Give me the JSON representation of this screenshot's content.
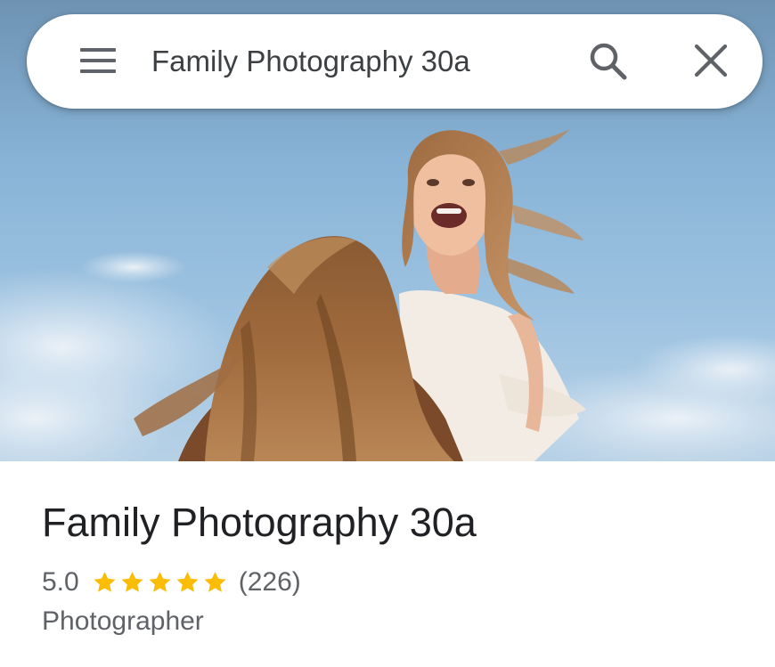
{
  "search": {
    "query": "Family Photography 30a",
    "menu_icon": "menu-icon",
    "search_icon": "search-icon",
    "close_icon": "close-icon"
  },
  "hero": {
    "image_subject": "mother holding laughing girl against blue sky"
  },
  "place": {
    "title": "Family Photography 30a",
    "rating": "5.0",
    "star_count": 5,
    "reviews": "(226)",
    "category": "Photographer"
  },
  "colors": {
    "star": "#fbbc04",
    "text_primary": "#202124",
    "text_secondary": "#5f6368",
    "icon": "#5f6368"
  }
}
